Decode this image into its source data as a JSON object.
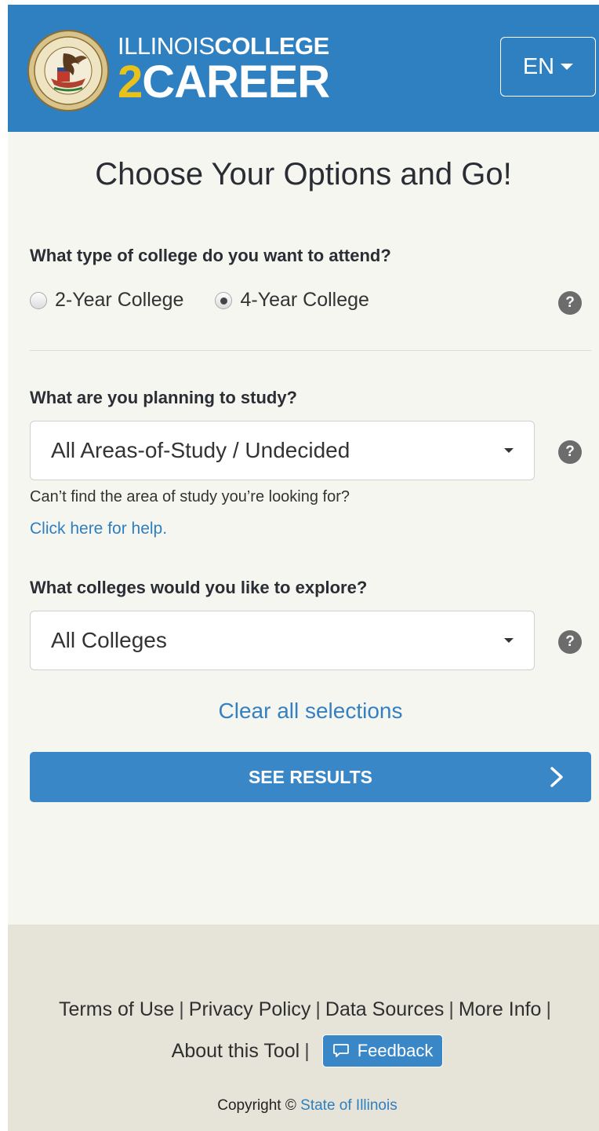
{
  "header": {
    "logo_line1_a": "ILLINOIS",
    "logo_line1_b": "COLLEGE",
    "logo_line2_a": "2",
    "logo_line2_b": "CAREER",
    "language_label": "EN"
  },
  "main": {
    "title": "Choose Your Options and Go!",
    "college_type": {
      "question": "What type of college do you want to attend?",
      "options": [
        {
          "label": "2-Year College",
          "selected": false
        },
        {
          "label": "4-Year College",
          "selected": true
        }
      ]
    },
    "study": {
      "question": "What are you planning to study?",
      "selected": "All Areas-of-Study / Undecided",
      "hint": "Can’t find the area of study you’re looking for?",
      "help_link": "Click here for help."
    },
    "colleges": {
      "question": "What colleges would you like to explore?",
      "selected": "All Colleges"
    },
    "help_icon": "?",
    "clear_label": "Clear all selections",
    "submit_label": "SEE RESULTS"
  },
  "footer": {
    "links": [
      "Terms of Use",
      "Privacy Policy",
      "Data Sources",
      "More Info",
      "About this Tool"
    ],
    "separator": "|",
    "feedback_label": "Feedback",
    "copyright_prefix": "Copyright ©",
    "copyright_link": "State of Illinois"
  },
  "colors": {
    "header_bg": "#2f80c0",
    "accent_gold": "#e8c21a",
    "button_blue": "#3a87c8",
    "link_blue": "#2f7fbf",
    "page_bg": "#f6f6f1",
    "footer_bg": "#e6e4d9"
  },
  "icons": [
    "state-seal-icon",
    "caret-down-icon",
    "help-icon",
    "chevron-right-icon",
    "speech-bubble-icon"
  ]
}
